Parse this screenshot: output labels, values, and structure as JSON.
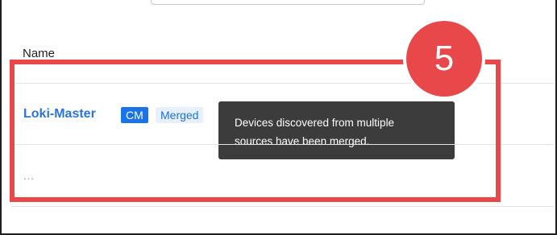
{
  "table": {
    "column_header": "Name",
    "row": {
      "device_name": "Loki-Master",
      "badge_cm": "CM",
      "badge_merged": "Merged"
    },
    "next_row_placeholder": "..."
  },
  "tooltip": {
    "line1": "Devices discovered from multiple",
    "line2": "sources have been merged."
  },
  "annotation": {
    "step_number": "5",
    "color": "#e8484a"
  },
  "colors": {
    "link": "#2a74d9",
    "badge_primary": "#1a73e8",
    "badge_light": "#e8f0fe",
    "tooltip_bg": "#3c3c3c"
  }
}
